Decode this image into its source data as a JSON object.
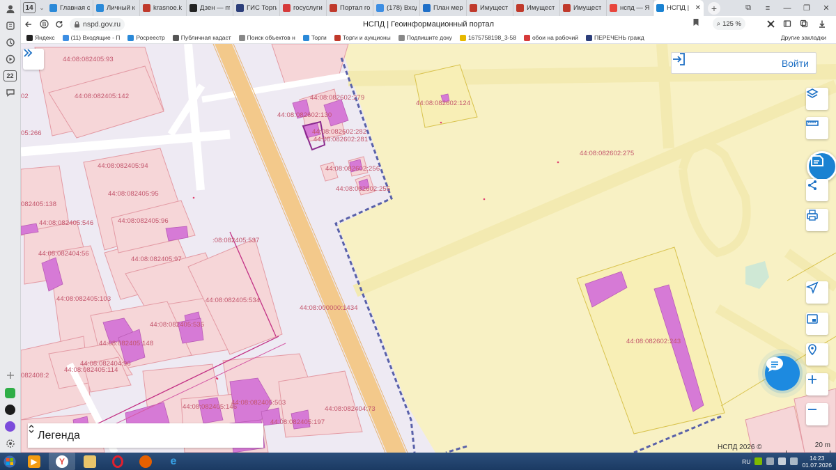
{
  "browser": {
    "tab_count": "14",
    "tabs": [
      {
        "title": "Главная с",
        "color": "#2a89d8"
      },
      {
        "title": "Личный к",
        "color": "#2a89d8"
      },
      {
        "title": "krasnoe.k",
        "color": "#c0392b"
      },
      {
        "title": "Дзен — m",
        "color": "#222222"
      },
      {
        "title": "ГИС Торги",
        "color": "#2c3e7a"
      },
      {
        "title": "госуслуги",
        "color": "#d63a3a"
      },
      {
        "title": "Портал го",
        "color": "#c0392b"
      },
      {
        "title": "(178) Вход",
        "color": "#3d8ee3"
      },
      {
        "title": "План мер",
        "color": "#1e6fc8"
      },
      {
        "title": "Имущест",
        "color": "#c0392b"
      },
      {
        "title": "Имущест",
        "color": "#c0392b"
      },
      {
        "title": "Имущест",
        "color": "#c0392b"
      },
      {
        "title": "нспд — Я",
        "color": "#e8453c"
      },
      {
        "title": "НСПД |",
        "color": "#1a82d2"
      }
    ],
    "new_tab_label": "+",
    "url": "nspd.gov.ru",
    "page_title": "НСПД | Геоинформационный портал",
    "zoom": "125 %",
    "bookmarks": [
      {
        "label": "Яндекс",
        "color": "#222222"
      },
      {
        "label": "(11) Входящие - П",
        "color": "#3d8ee3"
      },
      {
        "label": "Росреестр",
        "color": "#2a89d8"
      },
      {
        "label": "Публичная кадаст",
        "color": "#555555"
      },
      {
        "label": "Поиск объектов н",
        "color": "#888888"
      },
      {
        "label": "Торги",
        "color": "#2a89d8"
      },
      {
        "label": "Торги и аукционы",
        "color": "#c0392b"
      },
      {
        "label": "Подпишите доку",
        "color": "#888888"
      },
      {
        "label": "1675758198_3-58",
        "color": "#e6b800"
      },
      {
        "label": "обои на рабочий",
        "color": "#d63a3a"
      },
      {
        "label": "ПЕРЕЧЕНЬ гражд",
        "color": "#2c3e7a"
      }
    ],
    "bookmarks_other": "Другие закладки"
  },
  "map": {
    "login_label": "Войти",
    "legend_label": "Легенда",
    "copyright": "НСПД 2026 ©",
    "scale_label": "20 m",
    "parcel_labels": [
      {
        "id": "44:08:082405:93"
      },
      {
        "id": "44:08:082405:142"
      },
      {
        "id": "02"
      },
      {
        "id": "05:266"
      },
      {
        "id": "44:08:082602:279"
      },
      {
        "id": "44:08:082602:130"
      },
      {
        "id": "44:08:082602:282"
      },
      {
        "id": "44:08:082602:281"
      },
      {
        "id": "44:08:082602:124"
      },
      {
        "id": "44:08:082602:275"
      },
      {
        "id": "44:08:082405:94"
      },
      {
        "id": "44:08:082602:256"
      },
      {
        "id": "44:08:082405:95"
      },
      {
        "id": "44:08:082602:255"
      },
      {
        "id": "082405:138"
      },
      {
        "id": "44:08:082405:546"
      },
      {
        "id": "44:08:082405:96"
      },
      {
        "id": ":08:082405:537"
      },
      {
        "id": "44:08:082404:56"
      },
      {
        "id": "44:08:082405:97"
      },
      {
        "id": "44:08:082405:103"
      },
      {
        "id": "44:08:082405:534"
      },
      {
        "id": "44:08:000000:1434"
      },
      {
        "id": "44:08:082405:535"
      },
      {
        "id": "44:08:082602:243"
      },
      {
        "id": "44:08:082405:148"
      },
      {
        "id": "44:08:082404:96"
      },
      {
        "id": "44:08:082405:114"
      },
      {
        "id": "082408:2"
      },
      {
        "id": "44:08:082405:503"
      },
      {
        "id": "44:08:082405:146"
      },
      {
        "id": "44:08:082404:73"
      },
      {
        "id": "44:08:082405:197"
      }
    ]
  },
  "taskbar": {
    "language": "RU",
    "time": "14:23",
    "date": "01.07.2026"
  }
}
